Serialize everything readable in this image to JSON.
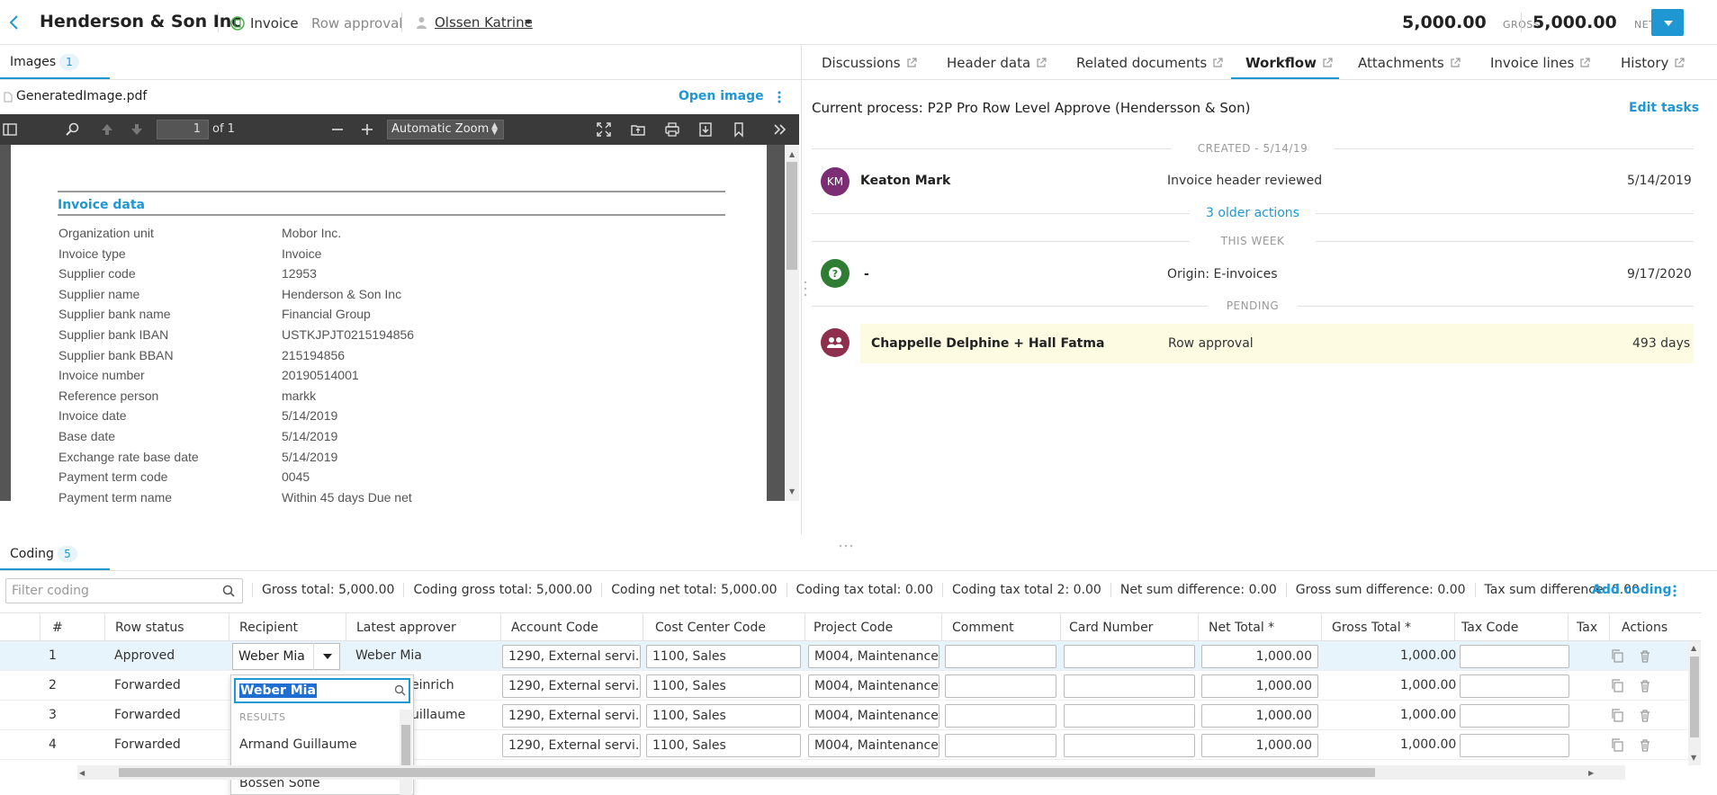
{
  "header": {
    "company": "Henderson & Son Inc",
    "doc_type": "Invoice",
    "stage": "Row approval",
    "user": "Olssen Katrine",
    "gross_amount": "5,000.00",
    "gross_label": "GROSS",
    "net_amount": "5,000.00",
    "net_label": "NET",
    "accent_color": "#1f97d3"
  },
  "images_pane": {
    "tab_label": "Images",
    "tab_count": "1",
    "file_name": "GeneratedImage.pdf",
    "open_image": "Open image",
    "pdf": {
      "page": "1",
      "of_pages": "of 1",
      "zoom": "Automatic Zoom"
    },
    "invoice": {
      "title": "Invoice data",
      "rows": [
        {
          "label": "Organization unit",
          "value": "Mobor Inc."
        },
        {
          "label": "Invoice type",
          "value": "Invoice"
        },
        {
          "label": "Supplier code",
          "value": "12953"
        },
        {
          "label": "Supplier name",
          "value": "Henderson & Son Inc"
        },
        {
          "label": "Supplier bank name",
          "value": "Financial Group"
        },
        {
          "label": "Supplier bank IBAN",
          "value": "USTKJPJT0215194856"
        },
        {
          "label": "Supplier bank BBAN",
          "value": "215194856"
        },
        {
          "label": "Invoice number",
          "value": "20190514001"
        },
        {
          "label": "Reference person",
          "value": "markk"
        },
        {
          "label": "Invoice date",
          "value": "5/14/2019"
        },
        {
          "label": "Base date",
          "value": "5/14/2019"
        },
        {
          "label": "Exchange rate base date",
          "value": "5/14/2019"
        },
        {
          "label": "Payment term code",
          "value": "0045"
        },
        {
          "label": "Payment term name",
          "value": "Within 45 days Due net"
        }
      ]
    }
  },
  "right_tabs": [
    "Discussions",
    "Header data",
    "Related documents",
    "Workflow",
    "Attachments",
    "Invoice lines",
    "History"
  ],
  "workflow": {
    "current_process": "Current process: P2P Pro Row Level Approve (Hendersson & Son)",
    "edit_tasks": "Edit tasks",
    "created_label": "CREATED - 5/14/19",
    "this_week_label": "THIS WEEK",
    "pending_label": "PENDING",
    "older_actions": "3 older actions",
    "entries": [
      {
        "initials": "KM",
        "name": "Keaton Mark",
        "action": "Invoice header reviewed",
        "date": "5/14/2019"
      },
      {
        "initials": "?",
        "name": "-",
        "action": "Origin: E-invoices",
        "date": "9/17/2020"
      },
      {
        "initials": "",
        "name": "Chappelle Delphine + Hall Fatma",
        "action": "Row approval",
        "date": "493 days"
      }
    ]
  },
  "coding": {
    "tab_label": "Coding",
    "tab_count": "5",
    "filter_placeholder": "Filter coding",
    "totals": [
      "Gross total: 5,000.00",
      "Coding gross total: 5,000.00",
      "Coding net total: 5,000.00",
      "Coding tax total: 0.00",
      "Coding tax total 2: 0.00",
      "Net sum difference: 0.00",
      "Gross sum difference: 0.00",
      "Tax sum difference: 0.00"
    ],
    "add_coding": "Add coding",
    "columns": [
      "#",
      "Row status",
      "Recipient",
      "Latest approver",
      "Account Code",
      "Cost Center Code",
      "Project Code",
      "Comment",
      "Card Number",
      "Net Total *",
      "Gross Total *",
      "Tax Code",
      "Tax",
      "Actions"
    ],
    "rows": [
      {
        "num": "1",
        "status": "Approved",
        "recipient": "Weber Mia",
        "approver": "Weber Mia",
        "account": "1290, External servi...",
        "cost_center": "1100, Sales",
        "project": "M004, Maintenance",
        "net": "1,000.00",
        "gross": "1,000.00"
      },
      {
        "num": "2",
        "status": "Forwarded",
        "recipient": "",
        "approver": "einrich",
        "account": "1290, External servi...",
        "cost_center": "1100, Sales",
        "project": "M004, Maintenance",
        "net": "1,000.00",
        "gross": "1,000.00"
      },
      {
        "num": "3",
        "status": "Forwarded",
        "recipient": "",
        "approver": "uillaume",
        "account": "1290, External servi...",
        "cost_center": "1100, Sales",
        "project": "M004, Maintenance",
        "net": "1,000.00",
        "gross": "1,000.00"
      },
      {
        "num": "4",
        "status": "Forwarded",
        "recipient": "",
        "approver": "",
        "account": "1290, External servi...",
        "cost_center": "1100, Sales",
        "project": "M004, Maintenance",
        "net": "1,000.00",
        "gross": "1,000.00"
      }
    ],
    "dropdown": {
      "search_value": "Weber Mia",
      "results_label": "RESULTS",
      "items": [
        "Armand Guillaume",
        "Bossen Sofie"
      ]
    }
  }
}
